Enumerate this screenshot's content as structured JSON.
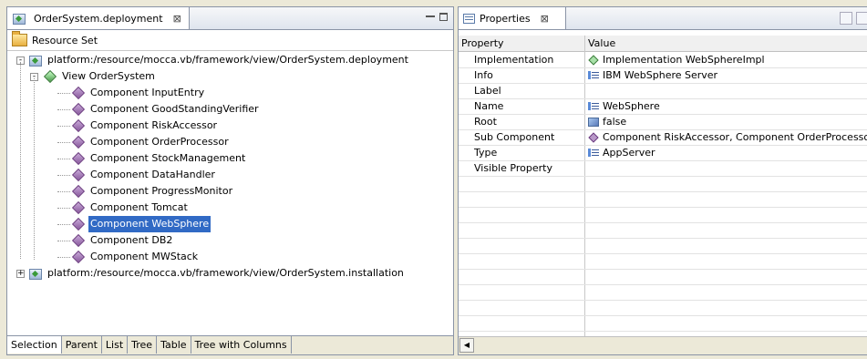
{
  "left_view": {
    "tab_title": "OrderSystem.deployment",
    "close_glyph": "⊠",
    "resource_bar_label": "Resource Set",
    "tree": [
      {
        "label": "platform:/resource/mocca.vb/framework/view/OrderSystem.deployment",
        "level": 0,
        "icon": "resource-icon",
        "expander": "-"
      },
      {
        "label": "View OrderSystem",
        "level": 1,
        "icon": "green-diamond-icon",
        "expander": "-"
      },
      {
        "label": "Component InputEntry",
        "level": 2,
        "icon": "purple-diamond-icon"
      },
      {
        "label": "Component GoodStandingVerifier",
        "level": 2,
        "icon": "purple-diamond-icon"
      },
      {
        "label": "Component RiskAccessor",
        "level": 2,
        "icon": "purple-diamond-icon"
      },
      {
        "label": "Component OrderProcessor",
        "level": 2,
        "icon": "purple-diamond-icon"
      },
      {
        "label": "Component StockManagement",
        "level": 2,
        "icon": "purple-diamond-icon"
      },
      {
        "label": "Component DataHandler",
        "level": 2,
        "icon": "purple-diamond-icon"
      },
      {
        "label": "Component ProgressMonitor",
        "level": 2,
        "icon": "purple-diamond-icon"
      },
      {
        "label": "Component Tomcat",
        "level": 2,
        "icon": "purple-diamond-icon"
      },
      {
        "label": "Component WebSphere",
        "level": 2,
        "icon": "purple-diamond-icon",
        "selected": true
      },
      {
        "label": "Component DB2",
        "level": 2,
        "icon": "purple-diamond-icon"
      },
      {
        "label": "Component MWStack",
        "level": 2,
        "icon": "purple-diamond-icon"
      },
      {
        "label": "platform:/resource/mocca.vb/framework/view/OrderSystem.installation",
        "level": 0,
        "icon": "resource-icon",
        "expander": "+"
      }
    ],
    "bottom_tabs": [
      "Selection",
      "Parent",
      "List",
      "Tree",
      "Table",
      "Tree with Columns"
    ],
    "active_bottom_tab": "Selection"
  },
  "properties_view": {
    "tab_title": "Properties",
    "close_glyph": "⊠",
    "columns": {
      "property": "Property",
      "value": "Value"
    },
    "rows": [
      {
        "property": "Implementation",
        "value": "Implementation WebSphereImpl",
        "icon": "green-diamond-icon"
      },
      {
        "property": "Info",
        "value": "IBM WebSphere Server",
        "icon": "list-icon"
      },
      {
        "property": "Label",
        "value": "",
        "icon": ""
      },
      {
        "property": "Name",
        "value": "WebSphere",
        "icon": "list-icon"
      },
      {
        "property": "Root",
        "value": "false",
        "icon": "boolean-icon"
      },
      {
        "property": "Sub Component",
        "value": "Component RiskAccessor, Component OrderProcessor",
        "icon": "purple-diamond-icon"
      },
      {
        "property": "Type",
        "value": "AppServer",
        "icon": "list-icon"
      },
      {
        "property": "Visible Property",
        "value": "",
        "icon": ""
      }
    ],
    "empty_rows": 12
  }
}
